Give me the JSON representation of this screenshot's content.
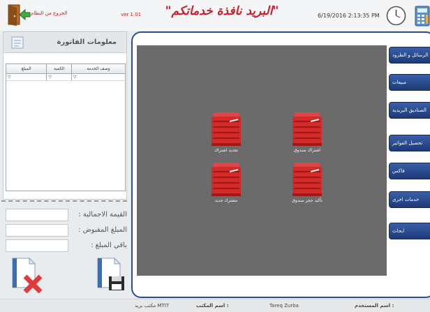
{
  "header": {
    "exit_label": "الخروج من النظام",
    "version": "ver 1.01",
    "title": "\"البريد نافذة خدماتكم\"",
    "datetime": "6/19/2016 2:13:35 PM"
  },
  "invoice": {
    "title": "معلومات الفاتورة",
    "columns": [
      "المبلغ",
      "الكمية",
      "وصف الخدمة"
    ],
    "filter_symbol": "▽"
  },
  "totals": {
    "total_label": "القيمة الاجمالية :",
    "paid_label": "المبلغ المقبوض :",
    "remaining_label": "باقي المبلغ :"
  },
  "services": {
    "renew_subscription": "تجديد اشتراك",
    "box_subscription": "اشتراك صندوق",
    "new_subscriber": "مشترك جديد",
    "confirm_box_reservation": "تأكيد حجز صندوق"
  },
  "menu": [
    "الرسائل و الطرود",
    "مبيعات",
    "الصناديق البريدية",
    "تحصيل الفواتير",
    "فاكس",
    "خدمات اخرى",
    "ابحاث"
  ],
  "status": {
    "user_label": "اسم المستخدم :",
    "user_value": "Tareq Zurba",
    "office_label": "اسم المكتب :",
    "office_value": "مكتب بريد MTIT"
  },
  "colors": {
    "accent": "#2e4f8e",
    "title_red": "#c8202a",
    "box_red": "#d32a2a",
    "workspace_gray": "#6b6b6b"
  }
}
